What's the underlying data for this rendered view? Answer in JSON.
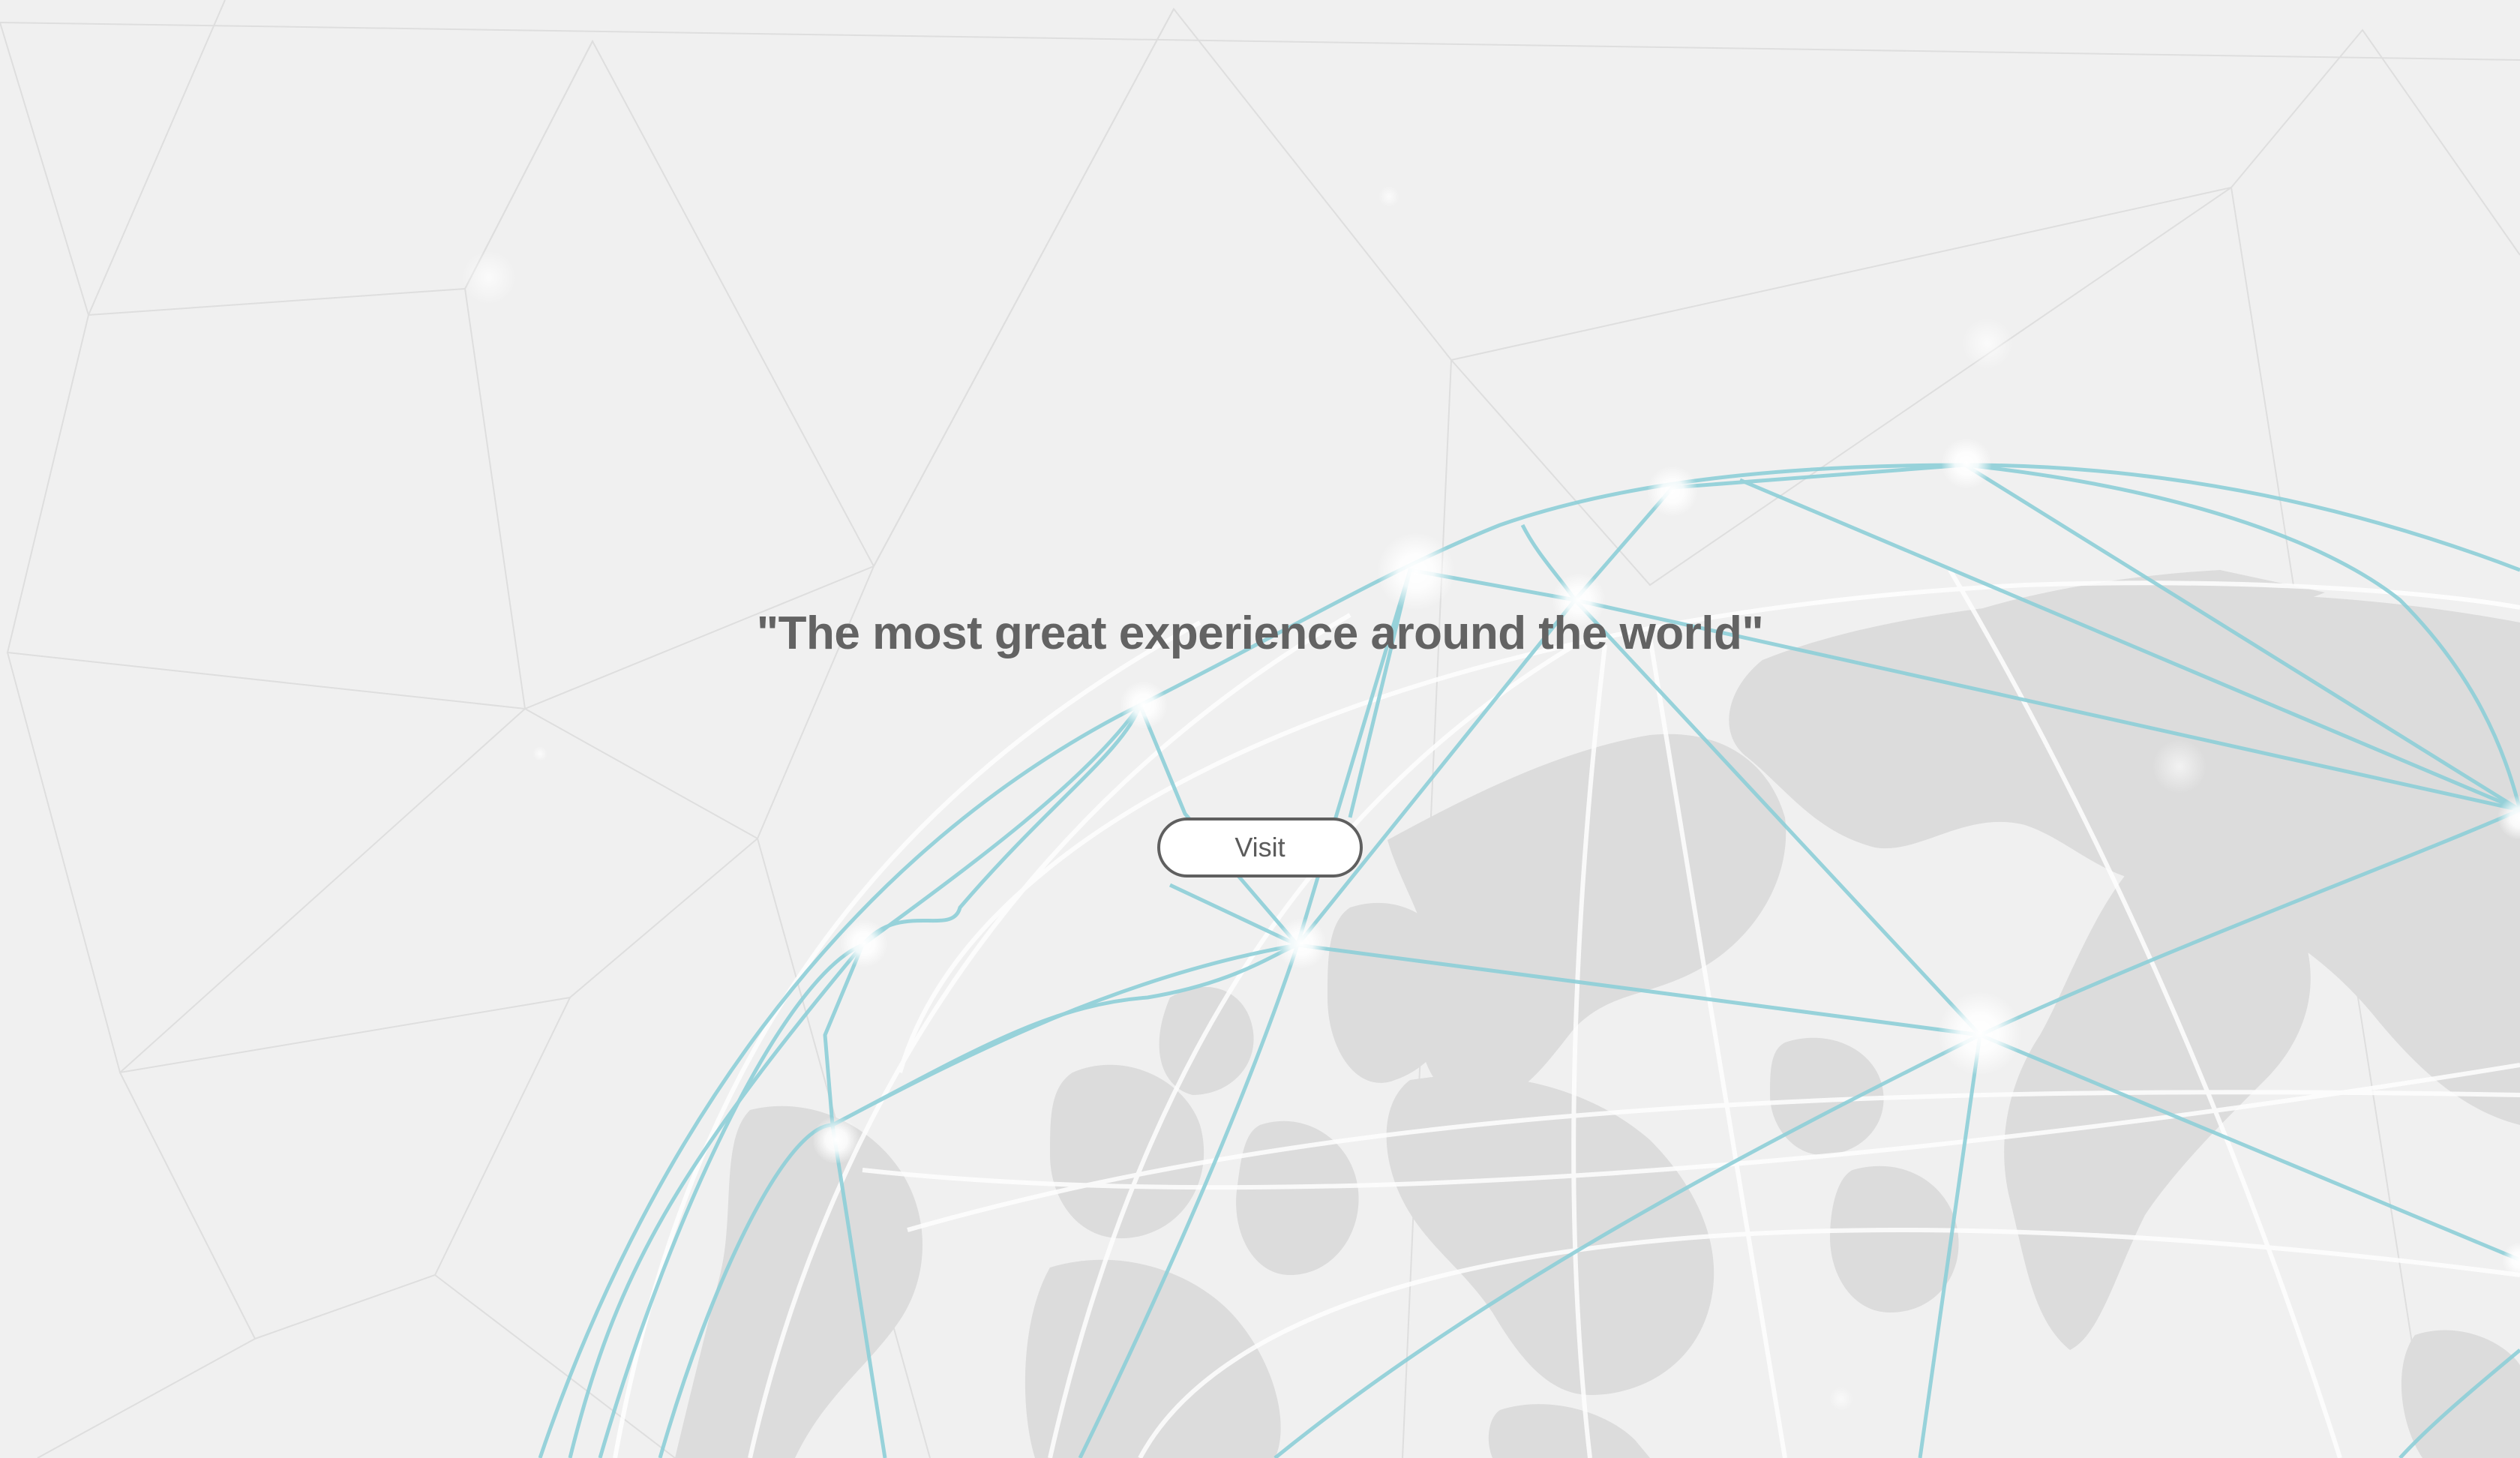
{
  "hero": {
    "headline": "\"The most great experience around the world\"",
    "button_label": "Visit"
  },
  "colors": {
    "background": "#f0f0f0",
    "text": "#636363",
    "network_line": "#8ecfd8",
    "landmass": "#dcdcdc",
    "button_border": "#5f5f5f"
  },
  "icons": {
    "background": "globe-network-illustration"
  }
}
